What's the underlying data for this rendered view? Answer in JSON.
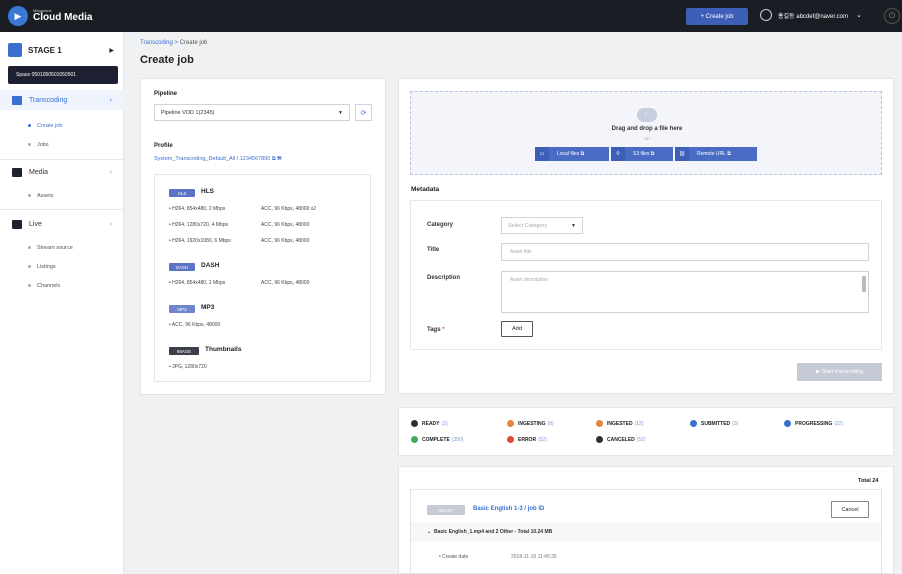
{
  "app": {
    "brand_small": "Megazone",
    "brand": "Cloud Media",
    "brand_icon": "play-icon"
  },
  "topbar": {
    "create_job": "+ Create job",
    "user": "홍길동 abcdef@naver.com"
  },
  "sidebar": {
    "stage": "STAGE 1",
    "space": "Space 0501050501050501",
    "groups": [
      {
        "label": "Transcoding",
        "items": [
          "Create job",
          "Jobs"
        ]
      },
      {
        "label": "Media",
        "items": [
          "Assets"
        ]
      },
      {
        "label": "Live",
        "items": [
          "Stream source",
          "Listings",
          "Channels"
        ]
      }
    ]
  },
  "breadcrumb": {
    "parent": "Transcoding",
    "sep": " > ",
    "current": "Create job"
  },
  "page_title": "Create job",
  "left_panel": {
    "pipeline_label": "Pipeline",
    "pipeline_value": "Pipeline VOD 1(2345)",
    "profile_label": "Profile",
    "profile_link": "System_Transcoding_Default_All / 1234567890",
    "profiles": [
      {
        "tag": "HLS",
        "name": "HLS",
        "tag_color": "#5b73c4",
        "specs": [
          [
            "• H264, 854x480, 2 Mbps",
            "ACC, 96 Kbps, 48000 x2"
          ],
          [
            "• H264, 1280x720, 4 Mbps",
            "ACC, 96 Kbps, 48000"
          ],
          [
            "• H264, 1920x1080, 6 Mbps",
            "ACC, 96 Kbps, 48000"
          ]
        ]
      },
      {
        "tag": "DASH",
        "name": "DASH",
        "tag_color": "#5b73c4",
        "specs": [
          [
            "• H264, 854x480, 2 Mbps",
            "ACC, 96 Kbps, 48000"
          ]
        ]
      },
      {
        "tag": "MP3",
        "name": "MP3",
        "tag_color": "#6f86cf",
        "specs": [
          [
            "• ACC, 96 Kbps, 48000",
            ""
          ]
        ]
      },
      {
        "tag": "IMAGE",
        "name": "Thumbnails",
        "tag_color": "#3a3f4a",
        "specs": [
          [
            "• JPG, 1280x720",
            ""
          ]
        ]
      }
    ]
  },
  "upload": {
    "drag_text": "Drag and drop a file here",
    "or_text": "- or -",
    "buttons": [
      "Local files",
      "S3 files",
      "Remote URL"
    ]
  },
  "metadata": {
    "title": "Metadata",
    "category_label": "Category",
    "category_value": "Select Category",
    "title_label": "Title",
    "title_placeholder": "Asset title",
    "description_label": "Description",
    "description_placeholder": "Asset description",
    "tags_label": "Tags",
    "required_mark": "*",
    "add_button": "Add"
  },
  "start_button": "▶  Start transcoding",
  "statuses": [
    {
      "label": "READY",
      "count": "(2)",
      "color": "#2b2f3a"
    },
    {
      "label": "INGESTING",
      "count": "(8)",
      "color": "#e9823b"
    },
    {
      "label": "INGESTED",
      "count": "(12)",
      "color": "#e9823b"
    },
    {
      "label": "SUBMITTED",
      "count": "(3)",
      "color": "#3a6fd0"
    },
    {
      "label": "PROGRESSING",
      "count": "(22)",
      "color": "#3a6fd0"
    },
    {
      "label": "COMPLETE",
      "count": "(350)",
      "color": "#3fae5b"
    },
    {
      "label": "ERROR",
      "count": "(52)",
      "color": "#e04b3a"
    },
    {
      "label": "CANCELED",
      "count": "(52)",
      "color": "#2b2f3a"
    }
  ],
  "jobs": {
    "total": "Total 24",
    "items": [
      {
        "status": "READY",
        "title": "Basic English 1-3 / job ID",
        "cancel": "Cancel",
        "files": "Basic English_1.mp4 and 2 Other - Total 10.24 MB",
        "create_date_label": "• Create date",
        "create_date": "2018-11-19  11:45:35"
      }
    ]
  }
}
